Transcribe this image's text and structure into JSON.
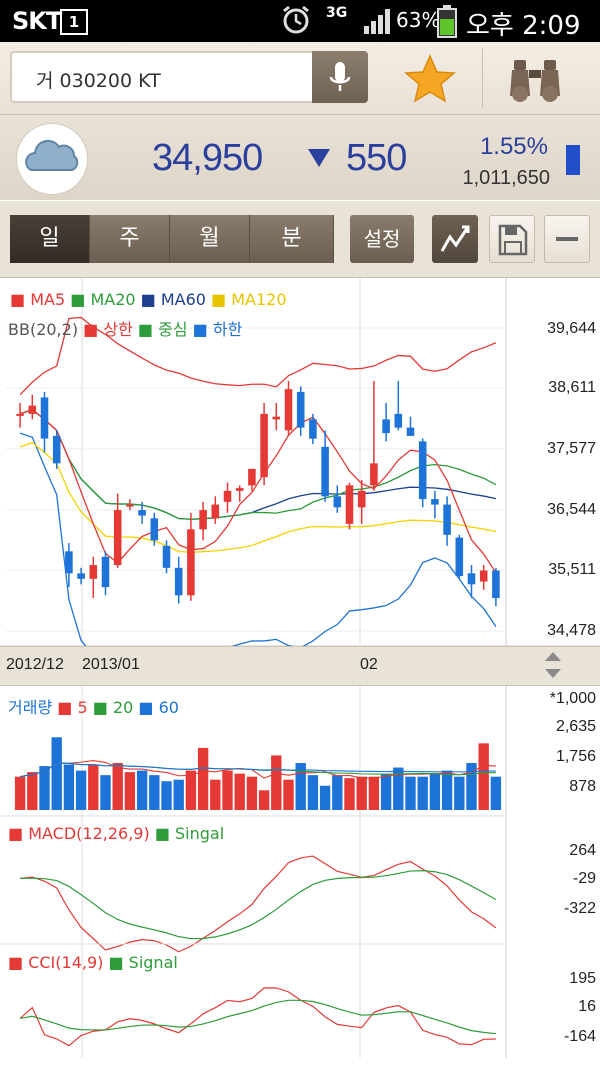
{
  "status_bar": {
    "carrier": "SKT",
    "sim": "1",
    "network": "3G",
    "battery": "63%",
    "time": "오후 2:09"
  },
  "search": {
    "value": "거 030200 KT"
  },
  "quote": {
    "price": "34,950",
    "change": "550",
    "change_direction": "down",
    "change_pct": "1.55%",
    "volume": "1,011,650"
  },
  "periods": {
    "tabs": [
      {
        "label": "일"
      },
      {
        "label": "주"
      },
      {
        "label": "월"
      },
      {
        "label": "분"
      }
    ],
    "active": "일",
    "settings_label": "설정"
  },
  "legend": {
    "ma": [
      {
        "label": "MA5",
        "color": "#e53935"
      },
      {
        "label": "MA20",
        "color": "#2e9c3a"
      },
      {
        "label": "MA60",
        "color": "#1d3f8f"
      },
      {
        "label": "MA120",
        "color": "#f5d200"
      }
    ],
    "bb_label": "BB(20,2)",
    "bb": [
      {
        "label": "상한",
        "color": "#e53935"
      },
      {
        "label": "중심",
        "color": "#2e9c3a"
      },
      {
        "label": "하한",
        "color": "#1e73d8"
      }
    ]
  },
  "axes": {
    "price_ticks": [
      "39,644",
      "38,611",
      "37,577",
      "36,544",
      "35,511",
      "34,478"
    ],
    "dates": [
      "2012/12",
      "2013/01",
      "02"
    ],
    "volume_ticks": [
      "*1,000",
      "2,635",
      "1,756",
      "878"
    ],
    "macd_ticks": [
      "264",
      "-29",
      "-322"
    ],
    "cci_ticks": [
      "195",
      "16",
      "-164"
    ]
  },
  "volume_legend": {
    "title": "거래량",
    "items": [
      {
        "label": "5",
        "color": "#e53935"
      },
      {
        "label": "20",
        "color": "#2e9c3a"
      },
      {
        "label": "60",
        "color": "#1e73d8"
      }
    ]
  },
  "macd_legend": {
    "title": "MACD(12,26,9)",
    "signal": "Singal"
  },
  "cci_legend": {
    "title": "CCI(14,9)",
    "signal": "Signal"
  },
  "colors": {
    "up": "#e53935",
    "down": "#1e73d8",
    "price_text": "#2b3f9d"
  },
  "chart_data": {
    "type": "candlestick",
    "price_axis": [
      34478,
      39644
    ],
    "candles": [
      {
        "o": 38300,
        "h": 38500,
        "l": 38050,
        "c": 38300
      },
      {
        "o": 38300,
        "h": 38650,
        "l": 38200,
        "c": 38450
      },
      {
        "o": 38600,
        "h": 38700,
        "l": 37600,
        "c": 37850
      },
      {
        "o": 37900,
        "h": 38000,
        "l": 37300,
        "c": 37400
      },
      {
        "o": 35800,
        "h": 35950,
        "l": 35150,
        "c": 35400
      },
      {
        "o": 35400,
        "h": 35500,
        "l": 35200,
        "c": 35300
      },
      {
        "o": 35300,
        "h": 35700,
        "l": 34950,
        "c": 35550
      },
      {
        "o": 35700,
        "h": 35800,
        "l": 35000,
        "c": 35150
      },
      {
        "o": 35550,
        "h": 36850,
        "l": 35500,
        "c": 36550
      },
      {
        "o": 36650,
        "h": 36750,
        "l": 36550,
        "c": 36650
      },
      {
        "o": 36550,
        "h": 36700,
        "l": 36300,
        "c": 36450
      },
      {
        "o": 36400,
        "h": 36500,
        "l": 35900,
        "c": 36000
      },
      {
        "o": 35900,
        "h": 36000,
        "l": 35400,
        "c": 35500
      },
      {
        "o": 35500,
        "h": 35700,
        "l": 34850,
        "c": 35000
      },
      {
        "o": 35000,
        "h": 36500,
        "l": 34900,
        "c": 36200
      },
      {
        "o": 36200,
        "h": 36700,
        "l": 36000,
        "c": 36550
      },
      {
        "o": 36400,
        "h": 36800,
        "l": 36300,
        "c": 36650
      },
      {
        "o": 36700,
        "h": 37050,
        "l": 36500,
        "c": 36900
      },
      {
        "o": 36900,
        "h": 37000,
        "l": 36700,
        "c": 36950
      },
      {
        "o": 37000,
        "h": 37300,
        "l": 36900,
        "c": 37300
      },
      {
        "o": 37150,
        "h": 38500,
        "l": 37000,
        "c": 38300
      },
      {
        "o": 38200,
        "h": 38500,
        "l": 38000,
        "c": 38250
      },
      {
        "o": 38000,
        "h": 38900,
        "l": 37900,
        "c": 38750
      },
      {
        "o": 38700,
        "h": 38800,
        "l": 37900,
        "c": 38050
      },
      {
        "o": 38200,
        "h": 38300,
        "l": 37750,
        "c": 37850
      },
      {
        "o": 37700,
        "h": 38000,
        "l": 36700,
        "c": 36800
      },
      {
        "o": 36800,
        "h": 37000,
        "l": 36500,
        "c": 36600
      },
      {
        "o": 36300,
        "h": 37050,
        "l": 36200,
        "c": 37000
      },
      {
        "o": 36600,
        "h": 37100,
        "l": 36300,
        "c": 36900
      },
      {
        "o": 37000,
        "h": 38900,
        "l": 36900,
        "c": 37400
      },
      {
        "o": 38200,
        "h": 38500,
        "l": 37800,
        "c": 37950
      },
      {
        "o": 38300,
        "h": 38900,
        "l": 38000,
        "c": 38050
      },
      {
        "o": 38050,
        "h": 38250,
        "l": 37900,
        "c": 37900
      },
      {
        "o": 37800,
        "h": 37850,
        "l": 36600,
        "c": 36750
      },
      {
        "o": 36750,
        "h": 36900,
        "l": 36400,
        "c": 36650
      },
      {
        "o": 36650,
        "h": 36800,
        "l": 35900,
        "c": 36100
      },
      {
        "o": 36050,
        "h": 36100,
        "l": 35300,
        "c": 35350
      },
      {
        "o": 35400,
        "h": 35550,
        "l": 34950,
        "c": 35200
      },
      {
        "o": 35250,
        "h": 35550,
        "l": 35100,
        "c": 35450
      },
      {
        "o": 35450,
        "h": 35500,
        "l": 34800,
        "c": 34950
      }
    ],
    "volume_axis": [
      0,
      3300
    ],
    "volume": [
      1100,
      1250,
      1450,
      2400,
      1500,
      1300,
      1500,
      1150,
      1550,
      1250,
      1300,
      1150,
      950,
      1000,
      1300,
      2050,
      1000,
      1300,
      1200,
      1100,
      650,
      1800,
      1000,
      1550,
      1150,
      800,
      1150,
      1050,
      1100,
      1100,
      1200,
      1400,
      1100,
      1100,
      1200,
      1300,
      1100,
      1550,
      2200,
      1100,
      1300
    ],
    "macd_axis": [
      -400,
      330
    ],
    "macd_signal_axis": [
      -400,
      330
    ],
    "cci_axis": [
      -230,
      260
    ]
  }
}
